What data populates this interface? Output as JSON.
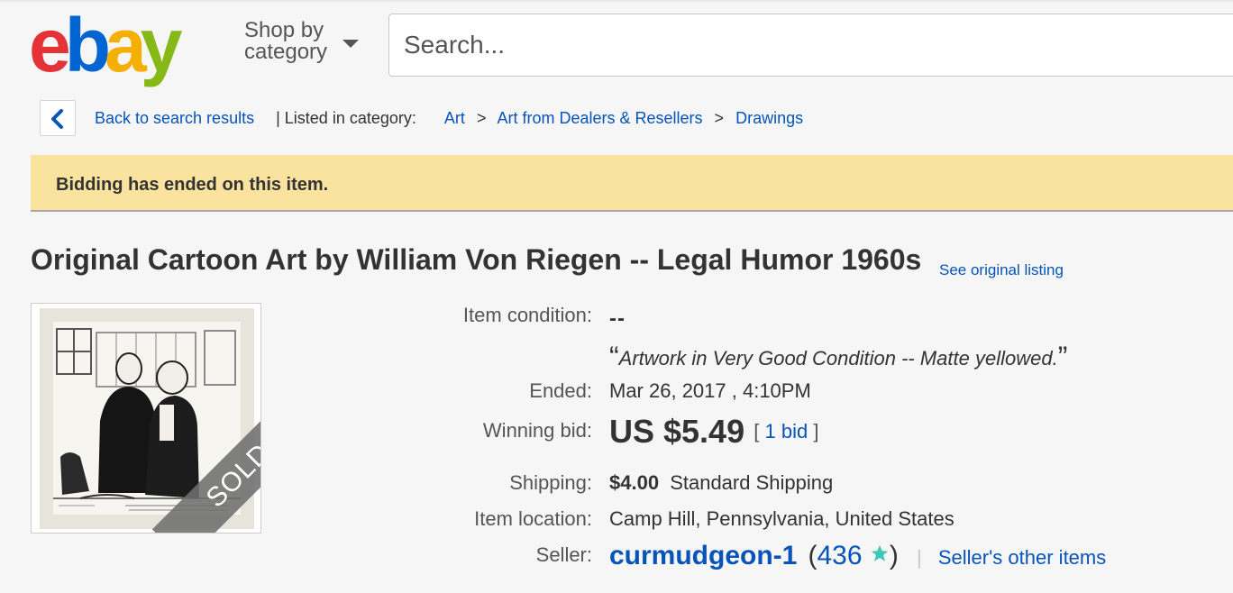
{
  "header": {
    "logo": {
      "letters": [
        "e",
        "b",
        "a",
        "y"
      ],
      "colors": [
        "#e53238",
        "#0064d2",
        "#f5af02",
        "#86b817"
      ]
    },
    "shop_by_line1": "Shop by",
    "shop_by_line2": "category",
    "search_placeholder": "Search..."
  },
  "breadcrumb": {
    "back_label": "Back to search results",
    "listed_in": "| Listed in category:",
    "categories": [
      "Art",
      "Art from Dealers & Resellers",
      "Drawings"
    ],
    "separator": ">"
  },
  "banner": {
    "message": "Bidding has ended on this item.",
    "background": "#f9e39e"
  },
  "listing": {
    "title": "Original Cartoon Art by William Von Riegen -- Legal Humor 1960s",
    "see_original": "See original listing",
    "image": {
      "alt": "Original cartoon drawing of two men in suits",
      "ribbon": "SOLD"
    },
    "details": {
      "condition_label": "Item condition:",
      "condition_value": "--",
      "condition_note_open": "“",
      "condition_note": "Artwork in Very Good Condition -- Matte yellowed.",
      "condition_note_close": "”",
      "ended_label": "Ended:",
      "ended_value": "Mar 26, 2017 , 4:10PM",
      "winning_bid_label": "Winning bid:",
      "winning_bid_value": "US $5.49",
      "bids_open": "[",
      "bids_link": "1 bid",
      "bids_close": "]",
      "shipping_label": "Shipping:",
      "shipping_amount": "$4.00",
      "shipping_method": "Standard Shipping",
      "location_label": "Item location:",
      "location_value": "Camp Hill, Pennsylvania, United States",
      "seller_label": "Seller:",
      "seller_name": "curmudgeon-1",
      "feedback_open": "(",
      "feedback_score": "436",
      "feedback_close": ")",
      "seller_other_items": "Seller's other items"
    }
  },
  "colors": {
    "link": "#0654ba",
    "star": "#3fc8b5"
  }
}
